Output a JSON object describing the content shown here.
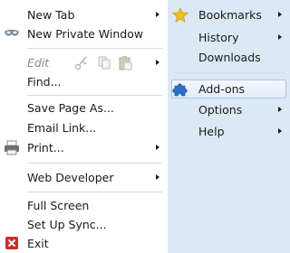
{
  "left": {
    "new_tab": "New Tab",
    "new_private_window": "New Private Window",
    "edit": "Edit",
    "find": "Find...",
    "save_page_as": "Save Page As...",
    "email_link": "Email Link...",
    "print": "Print...",
    "web_developer": "Web Developer",
    "full_screen": "Full Screen",
    "set_up_sync": "Set Up Sync...",
    "exit": "Exit"
  },
  "right": {
    "bookmarks": "Bookmarks",
    "history": "History",
    "downloads": "Downloads",
    "addons": "Add-ons",
    "options": "Options",
    "help": "Help"
  },
  "icons": {
    "private_window": "mask-icon",
    "edit_cut": "scissors-icon",
    "edit_copy": "copy-icon",
    "edit_paste": "paste-icon",
    "print": "printer-icon",
    "exit": "exit-icon",
    "bookmarks": "star-icon",
    "addons": "puzzle-piece-icon"
  },
  "colors": {
    "right_panel_bg": "#dde8f5",
    "highlight_border": "#a9c6e8",
    "addons_icon": "#2e6fc6",
    "bookmarks_icon": "#f0c419",
    "exit_icon": "#cc2b2b",
    "disabled_text": "#8a8a8a"
  },
  "state": {
    "highlighted_item": "Add-ons"
  }
}
